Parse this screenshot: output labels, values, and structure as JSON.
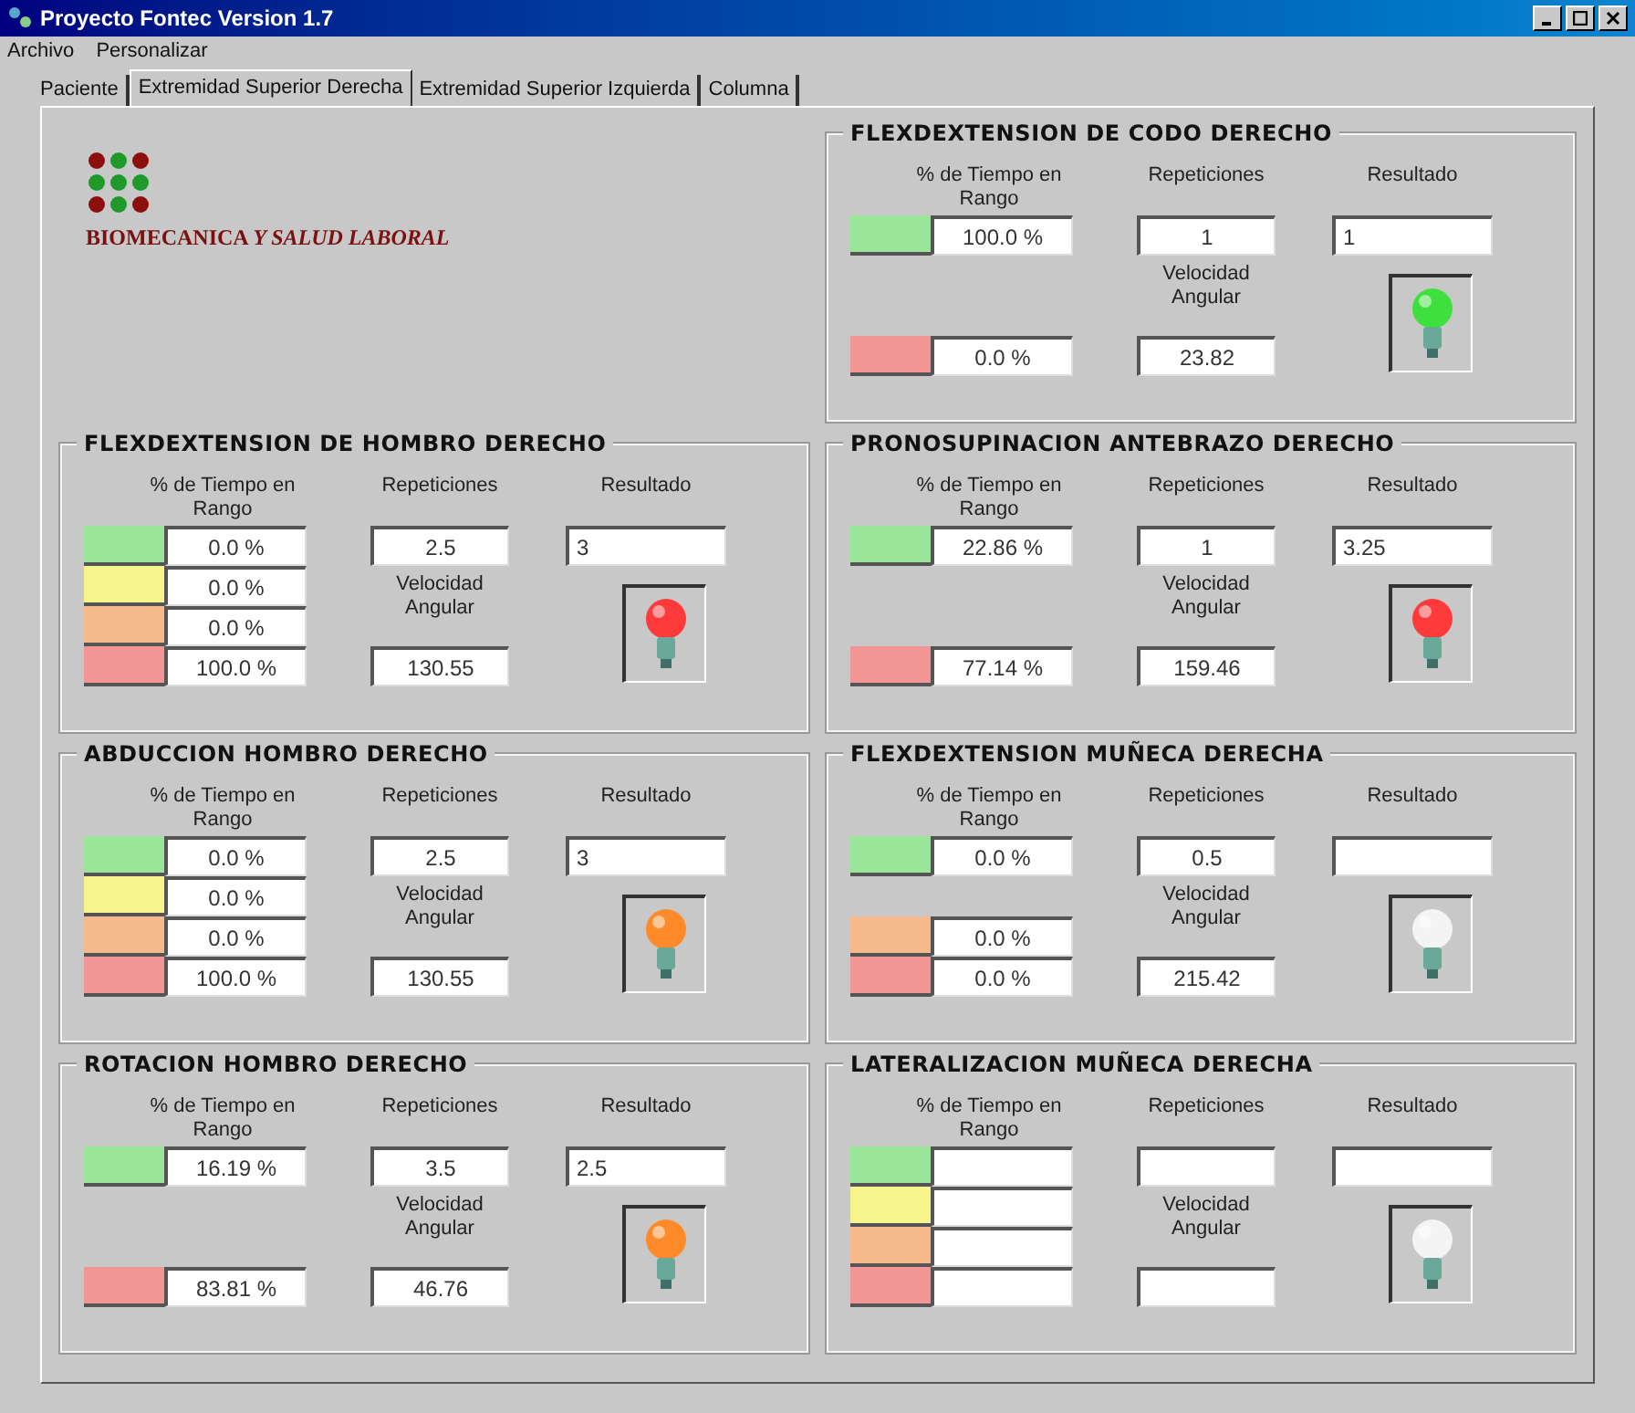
{
  "window": {
    "title": "Proyecto Fontec Version 1.7"
  },
  "menu": [
    "Archivo",
    "Personalizar"
  ],
  "tabs": [
    {
      "label": "Paciente",
      "selected": false
    },
    {
      "label": "Extremidad Superior Derecha",
      "selected": true
    },
    {
      "label": "Extremidad Superior Izquierda",
      "selected": false
    },
    {
      "label": "Columna",
      "selected": false
    }
  ],
  "logo": {
    "text": "BIOMECANICA *Y SALUD LABORAL*"
  },
  "panels": [
    {
      "title": "FLEXDEXTENSION DE CODO DERECHO",
      "time_label": "% de Tiempo en Rango",
      "repetitions_label": "Repeticiones",
      "result_label": "Resultado",
      "velocity_label": "Velocidad Angular",
      "ranges": [
        {
          "kind": "green",
          "value": "100.0 %"
        },
        {
          "kind": "red",
          "value": "0.0 %"
        }
      ],
      "repetitions": "1",
      "velocity": "23.82",
      "result": "1",
      "lamp": {
        "color": "#3ee03e"
      }
    },
    {
      "title": "FLEXDEXTENSION DE HOMBRO DERECHO",
      "time_label": "% de Tiempo en Rango",
      "repetitions_label": "Repeticiones",
      "result_label": "Resultado",
      "velocity_label": "Velocidad Angular",
      "ranges": [
        {
          "kind": "green",
          "value": "0.0 %"
        },
        {
          "kind": "yellow",
          "value": "0.0 %"
        },
        {
          "kind": "orange",
          "value": "0.0 %"
        },
        {
          "kind": "red",
          "value": "100.0 %"
        }
      ],
      "repetitions": "2.5",
      "velocity": "130.55",
      "result": "3",
      "lamp": {
        "color": "#ff3a3a"
      }
    },
    {
      "title": "PRONOSUPINACION ANTEBRAZO DERECHO",
      "time_label": "% de Tiempo en Rango",
      "repetitions_label": "Repeticiones",
      "result_label": "Resultado",
      "velocity_label": "Velocidad Angular",
      "ranges": [
        {
          "kind": "green",
          "value": "22.86 %"
        },
        {
          "kind": "red",
          "value": "77.14 %"
        }
      ],
      "repetitions": "1",
      "velocity": "159.46",
      "result": "3.25",
      "lamp": {
        "color": "#ff3a3a"
      }
    },
    {
      "title": "ABDUCCION HOMBRO DERECHO",
      "time_label": "% de Tiempo en Rango",
      "repetitions_label": "Repeticiones",
      "result_label": "Resultado",
      "velocity_label": "Velocidad Angular",
      "ranges": [
        {
          "kind": "green",
          "value": "0.0 %"
        },
        {
          "kind": "yellow",
          "value": "0.0 %"
        },
        {
          "kind": "orange",
          "value": "0.0 %"
        },
        {
          "kind": "red",
          "value": "100.0 %"
        }
      ],
      "repetitions": "2.5",
      "velocity": "130.55",
      "result": "3",
      "lamp": {
        "color": "#ff8a2a"
      }
    },
    {
      "title": "FLEXDEXTENSION MUÑECA DERECHA",
      "time_label": "% de Tiempo en Rango",
      "repetitions_label": "Repeticiones",
      "result_label": "Resultado",
      "velocity_label": "Velocidad Angular",
      "ranges": [
        {
          "kind": "green",
          "value": "0.0 %"
        },
        {
          "kind": "orange",
          "value": "0.0 %"
        },
        {
          "kind": "red",
          "value": "0.0 %"
        }
      ],
      "repetitions": "0.5",
      "velocity": "215.42",
      "lamp": {
        "color": "#f4f4f4"
      }
    },
    {
      "title": "ROTACION HOMBRO DERECHO",
      "time_label": "% de Tiempo en Rango",
      "repetitions_label": "Repeticiones",
      "result_label": "Resultado",
      "velocity_label": "Velocidad Angular",
      "ranges": [
        {
          "kind": "green",
          "value": "16.19 %"
        },
        {
          "kind": "red",
          "value": "83.81 %"
        }
      ],
      "repetitions": "3.5",
      "velocity": "46.76",
      "result": "2.5",
      "lamp": {
        "color": "#ff8a2a"
      }
    },
    {
      "title": "LATERALIZACION MUÑECA DERECHA",
      "time_label": "% de Tiempo en Rango",
      "repetitions_label": "Repeticiones",
      "result_label": "Resultado",
      "velocity_label": "Velocidad Angular",
      "ranges": [
        {
          "kind": "green"
        },
        {
          "kind": "yellow"
        },
        {
          "kind": "orange"
        },
        {
          "kind": "red"
        }
      ],
      "lamp": {
        "color": "#f4f4f4"
      }
    }
  ]
}
